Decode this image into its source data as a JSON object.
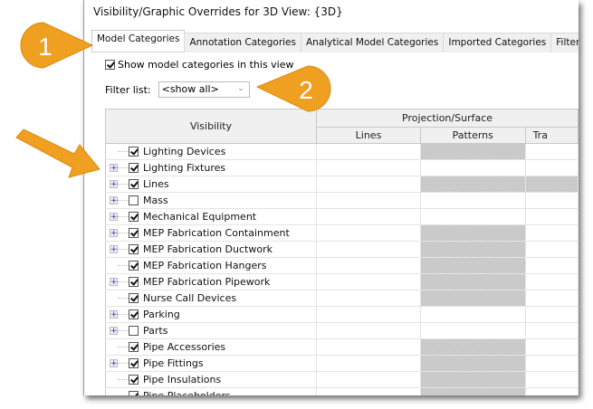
{
  "dialog": {
    "title": "Visibility/Graphic Overrides for 3D View: {3D}"
  },
  "tabs": [
    {
      "label": "Model Categories",
      "active": true
    },
    {
      "label": "Annotation Categories"
    },
    {
      "label": "Analytical Model Categories"
    },
    {
      "label": "Imported Categories"
    },
    {
      "label": "Filters"
    }
  ],
  "show_model": {
    "label": "Show model categories in this view",
    "checked": true
  },
  "filter": {
    "label": "Filter list:",
    "value": "<show all>"
  },
  "table": {
    "headers": {
      "visibility": "Visibility",
      "group": "Projection/Surface",
      "lines": "Lines",
      "patterns": "Patterns",
      "transparency": "Tra"
    },
    "rows": [
      {
        "name": "Lighting Devices",
        "checked": true,
        "expandable": false,
        "pattern_disabled": true
      },
      {
        "name": "Lighting Fixtures",
        "checked": true,
        "expandable": true,
        "pattern_disabled": false
      },
      {
        "name": "Lines",
        "checked": true,
        "expandable": true,
        "pattern_disabled": true
      },
      {
        "name": "Mass",
        "checked": false,
        "expandable": true,
        "pattern_disabled": false
      },
      {
        "name": "Mechanical Equipment",
        "checked": true,
        "expandable": true,
        "pattern_disabled": false
      },
      {
        "name": "MEP Fabrication Containment",
        "checked": true,
        "expandable": true,
        "pattern_disabled": true
      },
      {
        "name": "MEP Fabrication Ductwork",
        "checked": true,
        "expandable": true,
        "pattern_disabled": true
      },
      {
        "name": "MEP Fabrication Hangers",
        "checked": true,
        "expandable": false,
        "pattern_disabled": true
      },
      {
        "name": "MEP Fabrication Pipework",
        "checked": true,
        "expandable": true,
        "pattern_disabled": true
      },
      {
        "name": "Nurse Call Devices",
        "checked": true,
        "expandable": false,
        "pattern_disabled": true
      },
      {
        "name": "Parking",
        "checked": true,
        "expandable": true,
        "pattern_disabled": false
      },
      {
        "name": "Parts",
        "checked": false,
        "expandable": true,
        "pattern_disabled": false
      },
      {
        "name": "Pipe Accessories",
        "checked": true,
        "expandable": false,
        "pattern_disabled": true
      },
      {
        "name": "Pipe Fittings",
        "checked": true,
        "expandable": true,
        "pattern_disabled": true
      },
      {
        "name": "Pipe Insulations",
        "checked": true,
        "expandable": false,
        "pattern_disabled": true
      },
      {
        "name": "Pipe Placeholders",
        "checked": true,
        "expandable": false,
        "pattern_disabled": true
      }
    ]
  },
  "callouts": [
    {
      "number": "1"
    },
    {
      "number": "2"
    }
  ],
  "colors": {
    "callout": "#f0a020",
    "hatch": "#c8c8c8"
  }
}
